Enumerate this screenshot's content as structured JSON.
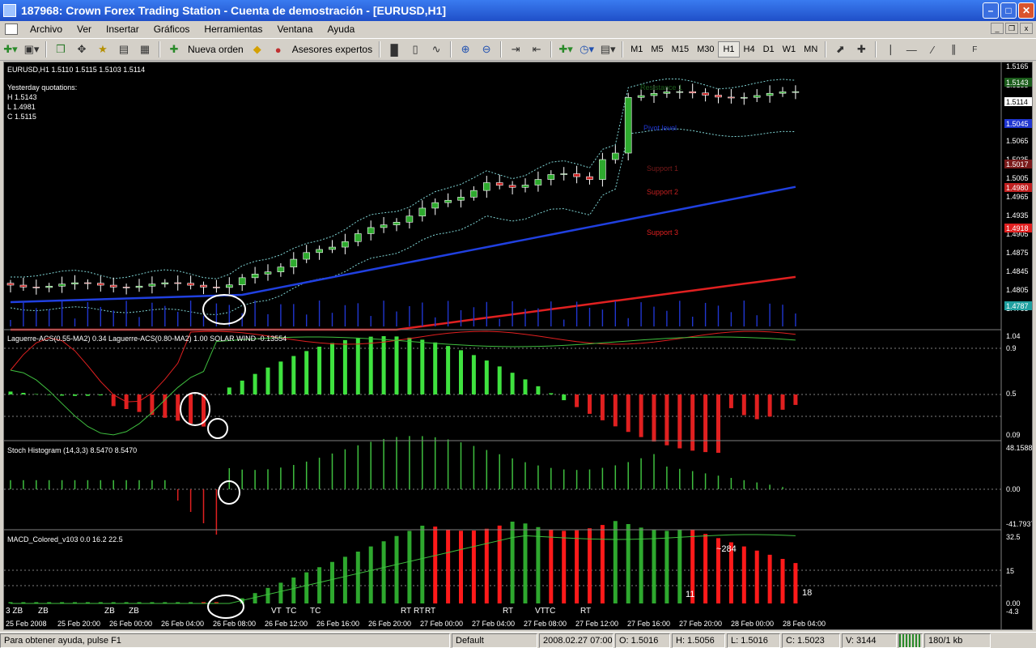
{
  "window": {
    "title": "187968: Crown Forex Trading Station - Cuenta de demostración - [EURUSD,H1]"
  },
  "menu": [
    "Archivo",
    "Ver",
    "Insertar",
    "Gráficos",
    "Herramientas",
    "Ventana",
    "Ayuda"
  ],
  "toolbar": {
    "new_order": "Nueva orden",
    "experts": "Asesores expertos",
    "timeframes": [
      "M1",
      "M5",
      "M15",
      "M30",
      "H1",
      "H4",
      "D1",
      "W1",
      "MN"
    ],
    "active_tf": "H1"
  },
  "chart": {
    "header": "EURUSD,H1  1.5110 1.5115 1.5103 1.5114",
    "yesterday": {
      "title": "Yesterday quotations:",
      "h": "H 1.5143",
      "l": "L 1.4981",
      "c": "C 1.5115"
    },
    "levels": {
      "resistance": "Resistance 1",
      "pivot": "Pivot level",
      "s1": "Support 1",
      "s2": "Support 2",
      "s3": "Support 3"
    },
    "price_ticks": [
      "1.5165",
      "1.5135",
      "1.5114",
      "1.5095",
      "1.5065",
      "1.5035",
      "1.5005",
      "1.4965",
      "1.4935",
      "1.4905",
      "1.4875",
      "1.4845",
      "1.4805",
      "1.4765"
    ],
    "price_badges": [
      "1.5143",
      "1.5114",
      "1.5045",
      "1.5017",
      "1.4980",
      "1.4918",
      "1.4787"
    ],
    "ind1_label": "Laguerre-ACS(0.55-MA2) 0.34  Laguerre-ACS(0.80-MA2) 1.00  SOLAR WIND -0.13554",
    "ind1_ticks": [
      "1.04",
      "0.9",
      "0.5",
      "0.09"
    ],
    "ind2_label": "Stoch Histogram (14,3,3) 8.5470 8.5470",
    "ind2_ticks": [
      "48.1588",
      "0.00",
      "-41.7937"
    ],
    "ind3_label": "MACD_Colored_v103 0.0 16.2 22.5",
    "ind3_ticks": [
      "32.5",
      "15",
      "0.00",
      "-4.3"
    ],
    "macd_annotations": [
      "~284",
      "11",
      "18"
    ],
    "macd_markers": [
      "3 ZB",
      "ZB",
      "ZB",
      "ZB",
      "VT",
      "TC",
      "TC",
      "RT",
      "RT",
      "RT",
      "RT",
      "VT",
      "TC",
      "RT"
    ],
    "time_labels": [
      "25 Feb 2008",
      "25 Feb 20:00",
      "26 Feb 00:00",
      "26 Feb 04:00",
      "26 Feb 08:00",
      "26 Feb 12:00",
      "26 Feb 16:00",
      "26 Feb 20:00",
      "27 Feb 00:00",
      "27 Feb 04:00",
      "27 Feb 08:00",
      "27 Feb 12:00",
      "27 Feb 16:00",
      "27 Feb 20:00",
      "28 Feb 00:00",
      "28 Feb 04:00"
    ]
  },
  "status": {
    "help": "Para obtener ayuda, pulse F1",
    "profile": "Default",
    "datetime": "2008.02.27 07:00",
    "open": "O: 1.5016",
    "high": "H: 1.5056",
    "low": "L: 1.5016",
    "close": "C: 1.5023",
    "volume": "V: 3144",
    "traffic": "180/1 kb"
  }
}
